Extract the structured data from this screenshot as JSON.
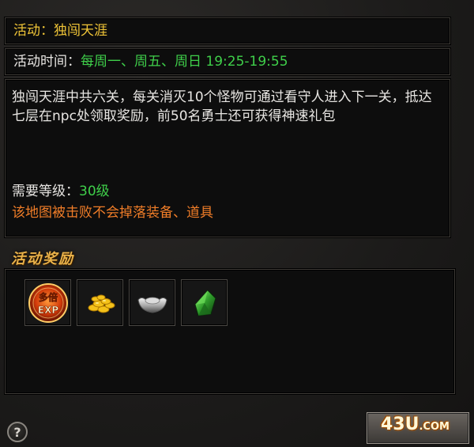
{
  "activity": {
    "label": "活动：",
    "name": "独闯天涯"
  },
  "schedule": {
    "label": "活动时间：",
    "value": "每周一、周五、周日 19:25-19:55"
  },
  "description": {
    "text": "独闯天涯中共六关，每关消灭10个怪物可通过看守人进入下一关，抵达七层在npc处领取奖励，前50名勇士还可获得神速礼包",
    "level_label": "需要等级：",
    "level_value": "30级",
    "warning": "该地图被击败不会掉落装备、道具"
  },
  "rewards": {
    "heading": "活动奖励",
    "items": [
      {
        "icon": "multi-exp-icon",
        "text_top": "多倍",
        "text_bottom": "EXP"
      },
      {
        "icon": "gold-coins-icon"
      },
      {
        "icon": "silver-ingot-icon"
      },
      {
        "icon": "green-gem-icon"
      }
    ]
  },
  "footer": {
    "help_symbol": "?",
    "watermark_main": "43U",
    "watermark_suffix": ".COM"
  }
}
